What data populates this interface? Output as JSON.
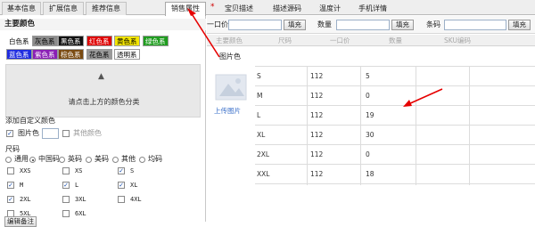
{
  "tabs": [
    {
      "label": "基本信息"
    },
    {
      "label": "扩展信息"
    },
    {
      "label": "推荐信息"
    },
    {
      "label": "销售属性"
    },
    {
      "label": "宝贝描述"
    },
    {
      "label": "描述源码"
    },
    {
      "label": "温度计"
    },
    {
      "label": "手机详情"
    }
  ],
  "tab_star": "*",
  "colors_section": {
    "title": "主要颜色",
    "chips": [
      {
        "label": "白色系",
        "bg": "#ffffff",
        "fg": "#000000"
      },
      {
        "label": "灰色系",
        "bg": "#8c8c8c",
        "fg": "#000000"
      },
      {
        "label": "黑色系",
        "bg": "#111111",
        "fg": "#ffffff"
      },
      {
        "label": "红色系",
        "bg": "#e00000",
        "fg": "#ffffff"
      },
      {
        "label": "黄色系",
        "bg": "#f3e500",
        "fg": "#000000"
      },
      {
        "label": "绿色系",
        "bg": "#1f9d1f",
        "fg": "#ffffff"
      },
      {
        "label": "蓝色系",
        "bg": "#1f2ce0",
        "fg": "#ffffff"
      },
      {
        "label": "紫色系",
        "bg": "#8a1fb5",
        "fg": "#ffffff"
      },
      {
        "label": "棕色系",
        "bg": "#7a4b12",
        "fg": "#ffffff"
      },
      {
        "label": "花色系",
        "bg": "#9a9a9a",
        "fg": "#000000"
      },
      {
        "label": "透明系",
        "bg": "#ffffff",
        "fg": "#000000"
      }
    ],
    "hint_arrow": "▲",
    "hint_text": "请点击上方的颜色分类"
  },
  "custom_color": {
    "title": "添加自定义颜色",
    "items": [
      {
        "label": "图片色",
        "checked": true
      },
      {
        "label": "其他颜色",
        "checked": false
      }
    ]
  },
  "size_section": {
    "title": "尺码",
    "radios": [
      {
        "label": "通用",
        "on": false
      },
      {
        "label": "中国码",
        "on": true
      },
      {
        "label": "英码",
        "on": false
      },
      {
        "label": "美码",
        "on": false
      },
      {
        "label": "其他",
        "on": false
      },
      {
        "label": "均码",
        "on": false
      }
    ],
    "sizes": [
      {
        "label": "XXS",
        "checked": false
      },
      {
        "label": "XS",
        "checked": false
      },
      {
        "label": "S",
        "checked": true
      },
      {
        "label": "M",
        "checked": true
      },
      {
        "label": "L",
        "checked": true
      },
      {
        "label": "XL",
        "checked": true
      },
      {
        "label": "2XL",
        "checked": true
      },
      {
        "label": "3XL",
        "checked": false
      },
      {
        "label": "4XL",
        "checked": false
      },
      {
        "label": "5XL",
        "checked": false
      },
      {
        "label": "6XL",
        "checked": false
      }
    ],
    "edit_button": "编辑备注"
  },
  "filter": {
    "price_label": "一口价",
    "price_value": "",
    "fill1": "填充",
    "qty_label": "数量",
    "qty_value": "",
    "fill2": "填充",
    "barcode_label": "条码",
    "barcode_value": "",
    "fill3": "填充"
  },
  "table": {
    "headers": [
      "主要颜色",
      "尺码",
      "一口价",
      "数量",
      "SKU编码"
    ],
    "group": "图片色",
    "upload_label": "上传图片",
    "rows": [
      {
        "size": "S",
        "price": "112",
        "qty": "5",
        "sku": ""
      },
      {
        "size": "M",
        "price": "112",
        "qty": "0",
        "sku": ""
      },
      {
        "size": "L",
        "price": "112",
        "qty": "19",
        "sku": ""
      },
      {
        "size": "XL",
        "price": "112",
        "qty": "30",
        "sku": ""
      },
      {
        "size": "2XL",
        "price": "112",
        "qty": "0",
        "sku": ""
      },
      {
        "size": "XXL",
        "price": "112",
        "qty": "18",
        "sku": ""
      }
    ]
  },
  "annotation_color": "#e60000"
}
